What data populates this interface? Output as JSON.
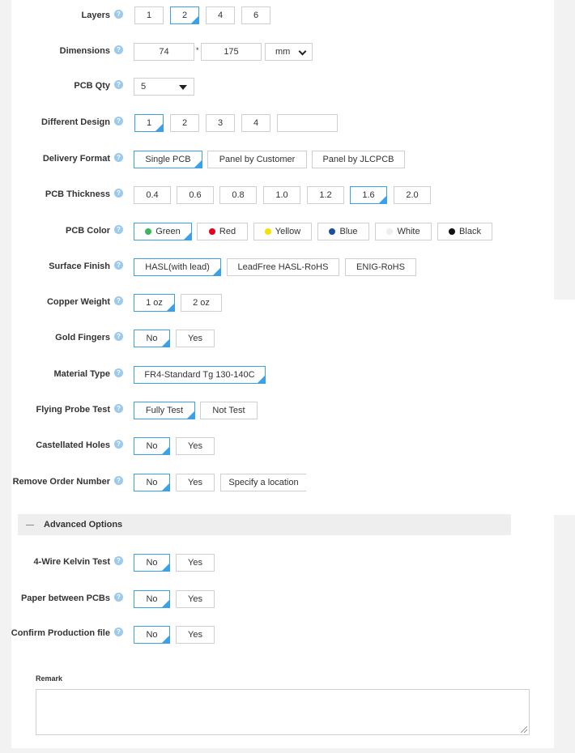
{
  "colors": {
    "accent": "#3aa0e8",
    "border": "#cfcfcf",
    "help": "#9cc9ee"
  },
  "help_glyph": "?",
  "layers": {
    "label": "Layers",
    "options": [
      "1",
      "2",
      "4",
      "6"
    ],
    "selected": "2"
  },
  "dimensions": {
    "label": "Dimensions",
    "width": "74",
    "separator": "*",
    "height": "175",
    "unit": "mm"
  },
  "pcb_qty": {
    "label": "PCB Qty",
    "value": "5"
  },
  "different_design": {
    "label": "Different Design",
    "options": [
      "1",
      "2",
      "3",
      "4"
    ],
    "selected": "1",
    "custom": ""
  },
  "delivery_format": {
    "label": "Delivery Format",
    "options": [
      "Single PCB",
      "Panel by Customer",
      "Panel by JLCPCB"
    ],
    "selected": "Single PCB"
  },
  "pcb_thickness": {
    "label": "PCB Thickness",
    "options": [
      "0.4",
      "0.6",
      "0.8",
      "1.0",
      "1.2",
      "1.6",
      "2.0"
    ],
    "selected": "1.6"
  },
  "pcb_color": {
    "label": "PCB Color",
    "options": [
      {
        "name": "Green",
        "color": "#3bb55e"
      },
      {
        "name": "Red",
        "color": "#e3001b"
      },
      {
        "name": "Yellow",
        "color": "#f6e100"
      },
      {
        "name": "Blue",
        "color": "#1a4fa0"
      },
      {
        "name": "White",
        "color": "#eeeeee"
      },
      {
        "name": "Black",
        "color": "#111111"
      }
    ],
    "selected": "Green"
  },
  "surface_finish": {
    "label": "Surface Finish",
    "options": [
      "HASL(with lead)",
      "LeadFree HASL-RoHS",
      "ENIG-RoHS"
    ],
    "selected": "HASL(with lead)"
  },
  "copper_weight": {
    "label": "Copper Weight",
    "options": [
      "1 oz",
      "2 oz"
    ],
    "selected": "1 oz"
  },
  "gold_fingers": {
    "label": "Gold Fingers",
    "options": [
      "No",
      "Yes"
    ],
    "selected": "No"
  },
  "material_type": {
    "label": "Material Type",
    "options": [
      "FR4-Standard Tg 130-140C"
    ],
    "selected": "FR4-Standard Tg 130-140C"
  },
  "flying_probe": {
    "label": "Flying Probe Test",
    "options": [
      "Fully Test",
      "Not Test"
    ],
    "selected": "Fully Test"
  },
  "castellated": {
    "label": "Castellated Holes",
    "options": [
      "No",
      "Yes"
    ],
    "selected": "No"
  },
  "remove_order": {
    "label": "Remove Order Number",
    "options": [
      "No",
      "Yes",
      "Specify a location"
    ],
    "selected": "No"
  },
  "advanced": {
    "minus": "−",
    "title": "Advanced Options"
  },
  "kelvin": {
    "label": "4-Wire Kelvin Test",
    "options": [
      "No",
      "Yes"
    ],
    "selected": "No"
  },
  "paper": {
    "label": "Paper between PCBs",
    "options": [
      "No",
      "Yes"
    ],
    "selected": "No"
  },
  "confirm_file": {
    "label": "Confirm Production file",
    "options": [
      "No",
      "Yes"
    ],
    "selected": "No"
  },
  "remark": {
    "label": "Remark",
    "value": ""
  }
}
